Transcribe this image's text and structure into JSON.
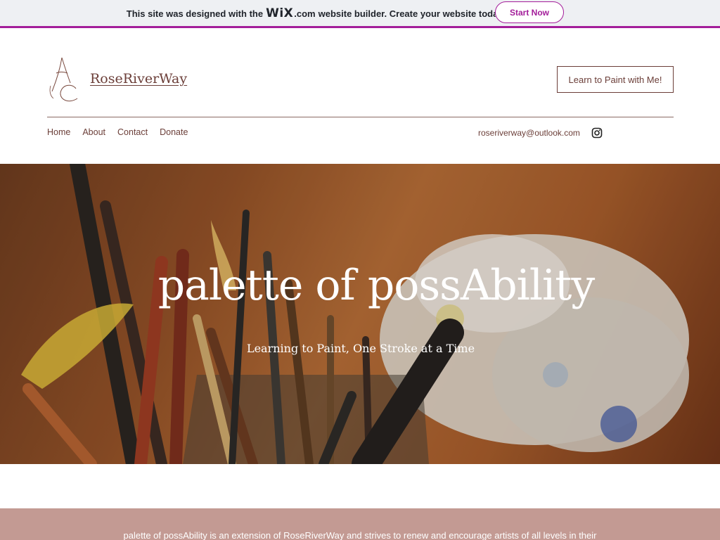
{
  "banner": {
    "text_before": "This site was designed with the",
    "wix_logo": "WiX",
    "wix_dotcom": ".com",
    "text_after": "website builder. Create your website today.",
    "start_button": "Start Now"
  },
  "header": {
    "site_title": "RoseRiverWay",
    "cta_button": "Learn to Paint with Me!",
    "nav": [
      {
        "label": "Home"
      },
      {
        "label": "About"
      },
      {
        "label": "Contact"
      },
      {
        "label": "Donate"
      }
    ],
    "email": "roseriverway@outlook.com",
    "social_icon": "instagram-icon"
  },
  "hero": {
    "title": "palette of possAbility",
    "subtitle": "Learning to Paint, One Stroke at a Time"
  },
  "about": {
    "text": "palette of possAbility is an extension of RoseRiverWay and strives to renew and encourage artists of all levels in their"
  },
  "colors": {
    "wix_accent": "#a31d9a",
    "brand_text": "#6b3e38",
    "about_bg": "#c39a93"
  }
}
